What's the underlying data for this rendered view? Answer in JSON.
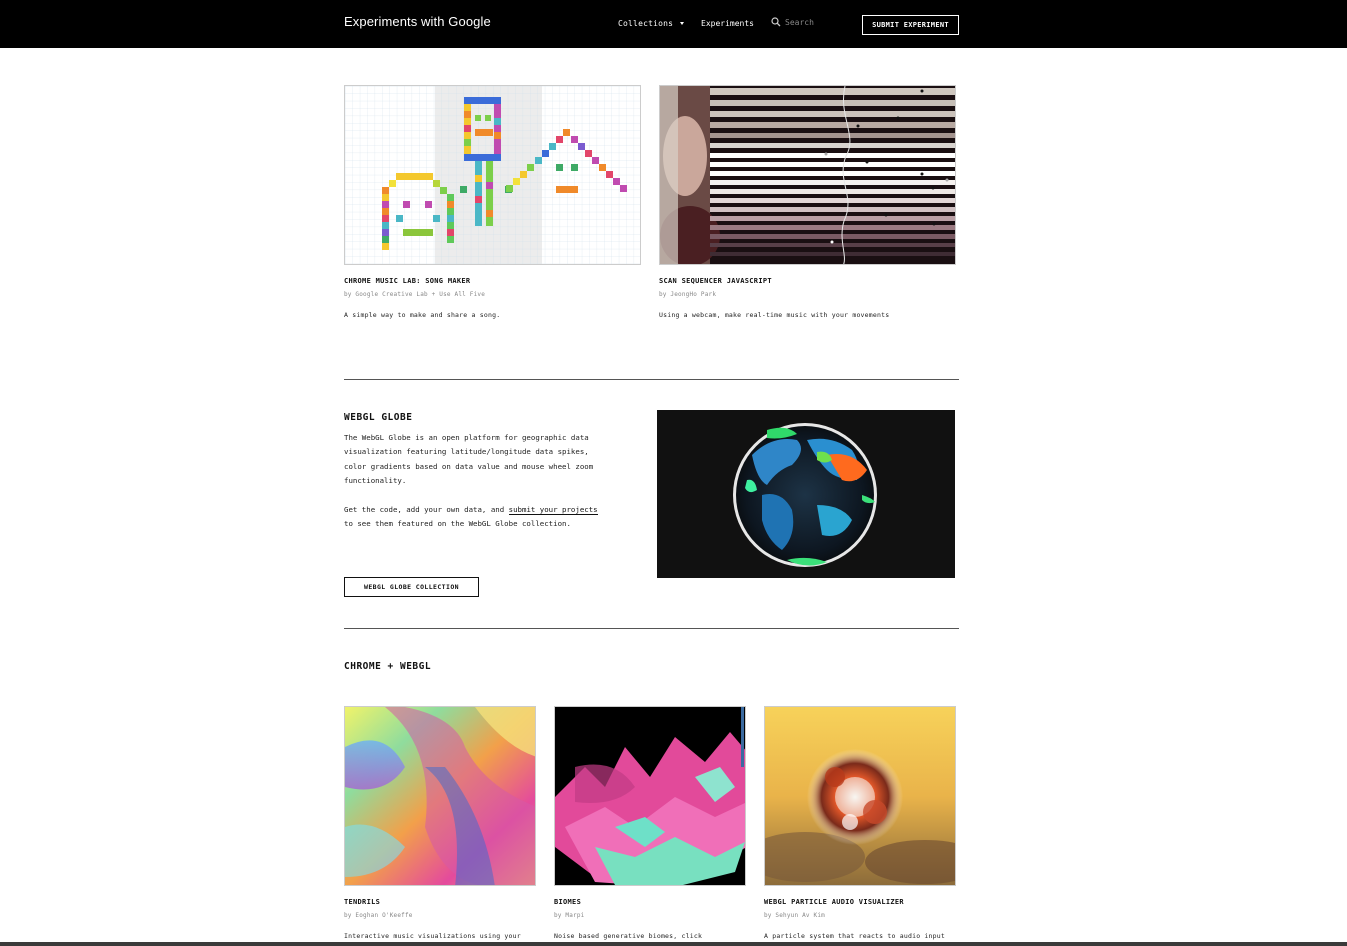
{
  "header": {
    "brand": "Experiments with Google",
    "collections_label": "Collections",
    "experiments_label": "Experiments",
    "search_placeholder": "Search",
    "submit_label": "SUBMIT EXPERIMENT"
  },
  "cut_heading": "CHROME + WEBGL",
  "top_cards": [
    {
      "title": "CHROME MUSIC LAB: SONG MAKER",
      "by": "by Google Creative Lab + Use All Five",
      "desc": "A simple way to make and share a song."
    },
    {
      "title": "SCAN SEQUENCER JAVASCRIPT",
      "by": "by JeongHo Park",
      "desc": "Using a webcam, make real-time music with your movements"
    }
  ],
  "globe": {
    "title": "WEBGL GLOBE",
    "para1": "The WebGL Globe is an open platform for geographic data visualization featuring latitude/longitude data spikes, color gradients based on data value and mouse wheel zoom functionality.",
    "para2_pre": "Get the code, add your own data, and ",
    "para2_link": "submit your projects",
    "para2_post": " to see them featured on the WebGL Globe collection.",
    "button_label": "WEBGL GLOBE COLLECTION"
  },
  "section_title": "CHROME + WEBGL",
  "bottom_cards": [
    {
      "title": "TENDRILS",
      "by": "by Eoghan O'Keeffe",
      "desc": "Interactive music visualizations using your"
    },
    {
      "title": "BIOMES",
      "by": "by Marpi",
      "desc": "Noise based generative biomes, click"
    },
    {
      "title": "WEBGL PARTICLE AUDIO VISUALIZER",
      "by": "by Sehyun Av Kim",
      "desc": "A particle system that reacts to audio input"
    }
  ]
}
